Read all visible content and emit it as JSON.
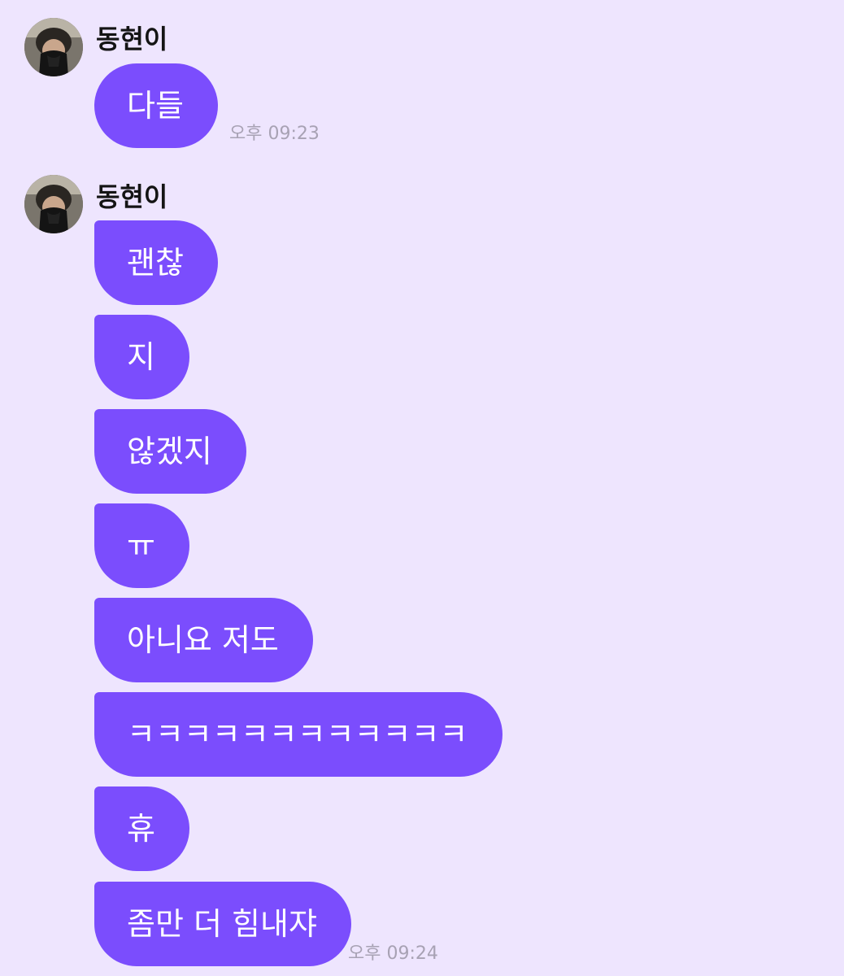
{
  "colors": {
    "background": "#eee5fe",
    "bubble": "#7b4dfd",
    "bubble_text": "#ffffff",
    "sender_name": "#141414",
    "timestamp": "#a8a2b4"
  },
  "groups": [
    {
      "sender": "동현이",
      "avatar_icon": "profile-photo",
      "messages": [
        "다들"
      ],
      "time": "오후 09:23"
    },
    {
      "sender": "동현이",
      "avatar_icon": "profile-photo",
      "messages": [
        "괜찮",
        "지",
        "않겠지",
        "ㅠ",
        "아니요 저도",
        "ㅋㅋㅋㅋㅋㅋㅋㅋㅋㅋㅋㅋ",
        "휴",
        "좀만 더 힘내쟈"
      ],
      "time": "오후 09:24"
    }
  ]
}
